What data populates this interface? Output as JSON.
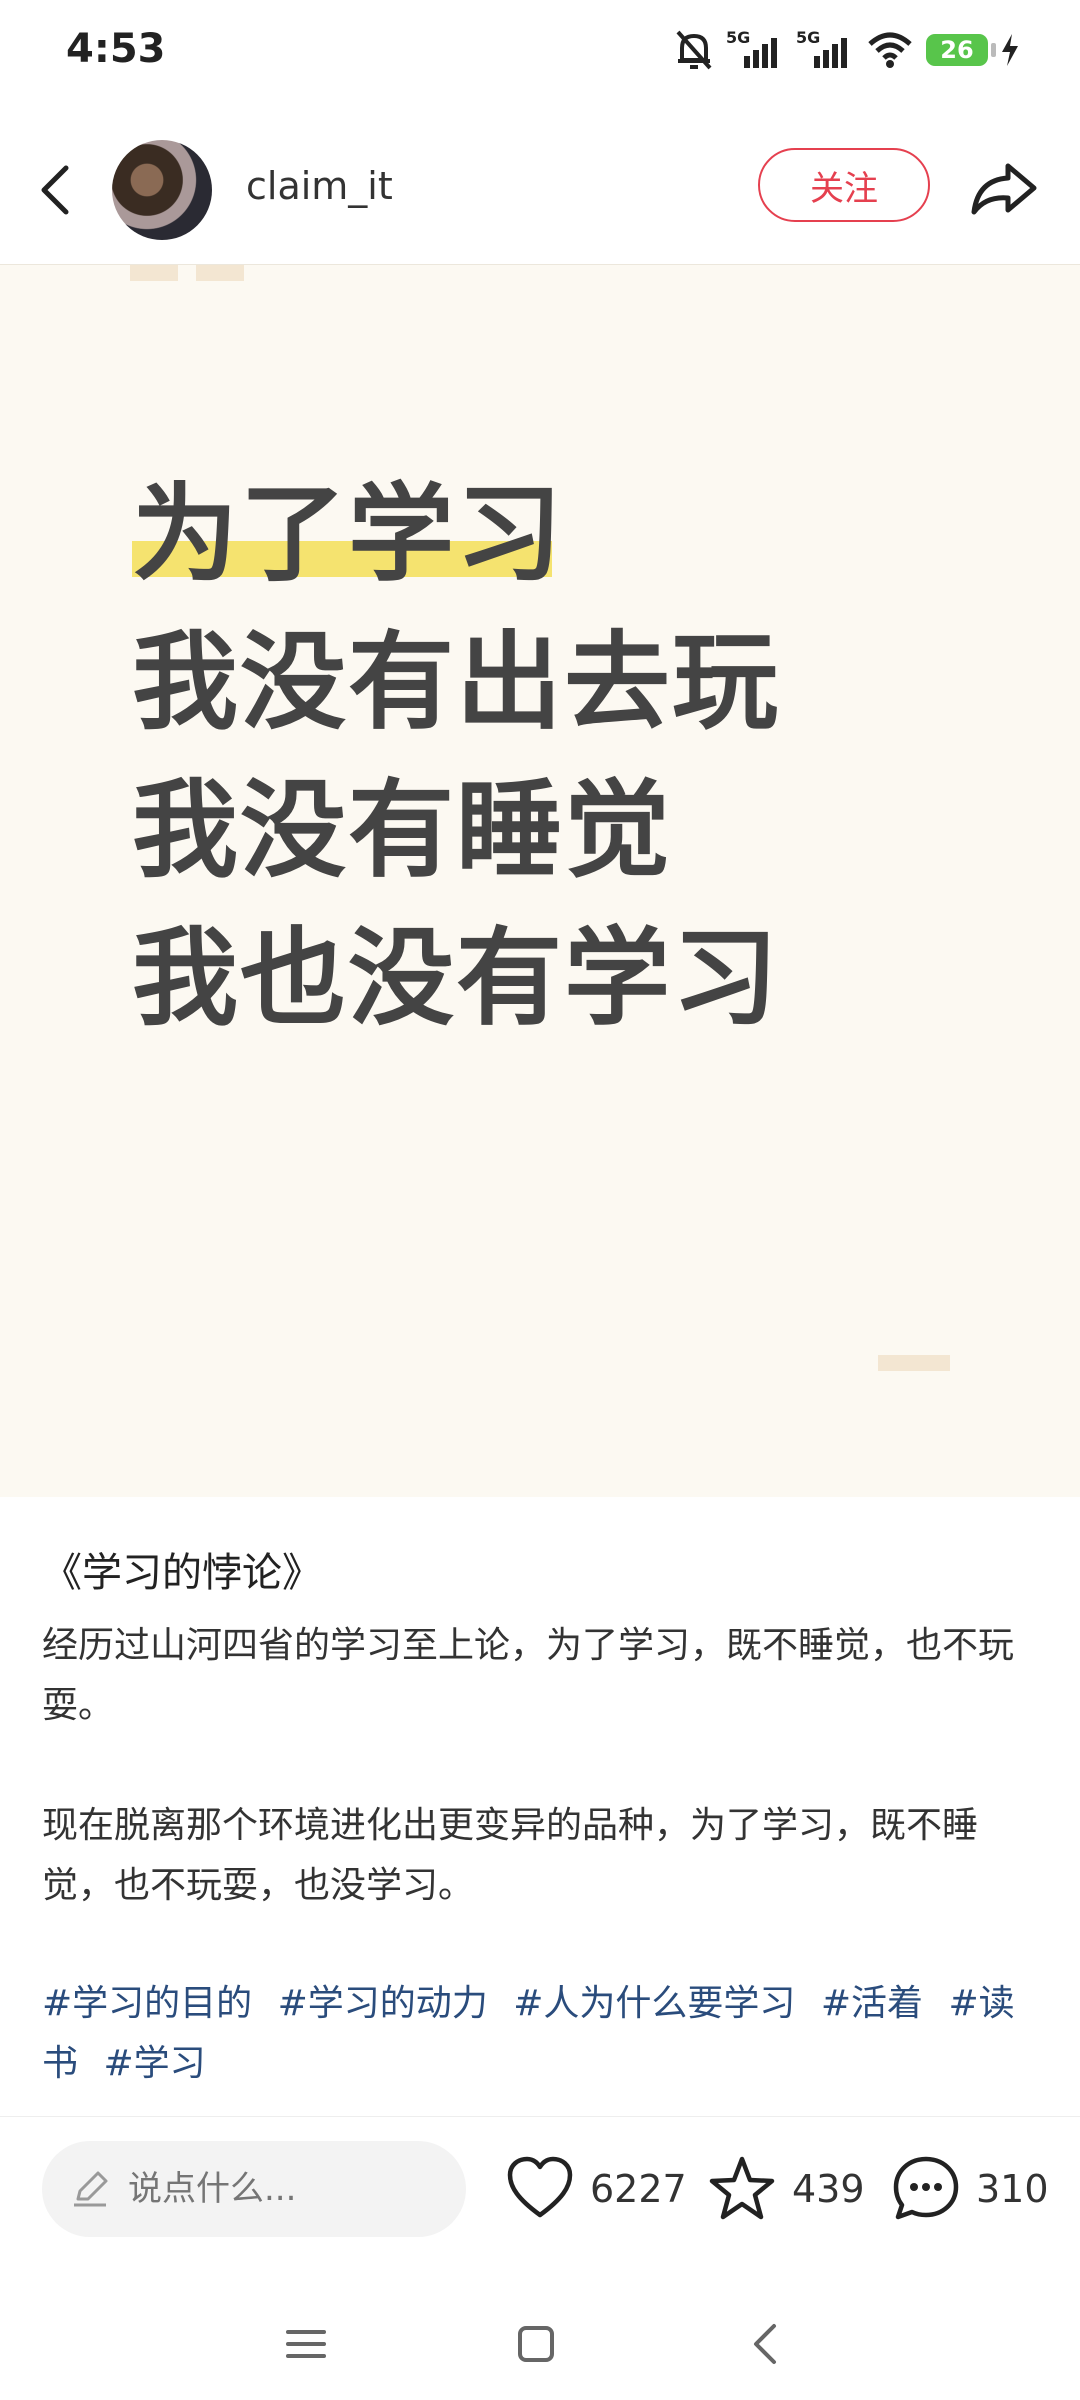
{
  "status_bar": {
    "time": "4:53",
    "signal_1_label": "5G",
    "signal_2_label": "5G",
    "battery_level": "26",
    "icons": [
      "bell-muted-icon",
      "signal-icon",
      "signal-icon",
      "wifi-icon",
      "battery-icon",
      "charging-icon"
    ]
  },
  "header": {
    "username": "claim_it",
    "follow_label": "关注"
  },
  "post_image": {
    "lines": [
      "为了学习",
      "我没有出去玩",
      "我没有睡觉",
      "我也没有学习"
    ],
    "highlight_color": "#f5e36f",
    "background": "#fcf9f2"
  },
  "post": {
    "title": "《学习的悖论》",
    "paragraphs": [
      "经历过山河四省的学习至上论，为了学习，既不睡觉，也不玩耍。",
      "现在脱离那个环境进化出更变异的品种，为了学习，既不睡觉，也不玩耍，也没学习。"
    ],
    "tags": [
      "#学习的目的",
      "#学习的动力",
      "#人为什么要学习",
      "#活着",
      "#读书",
      "#学习"
    ]
  },
  "actions": {
    "comment_placeholder": "说点什么...",
    "likes": "6227",
    "favorites": "439",
    "comments": "310"
  },
  "colors": {
    "accent_red": "#e5404f",
    "tag_blue": "#2a4c7c"
  }
}
